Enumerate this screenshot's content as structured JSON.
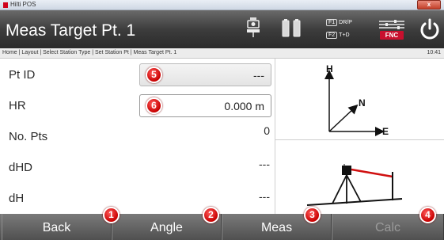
{
  "window": {
    "title": "Hilti POS",
    "close_label": "x"
  },
  "header": {
    "page_title": "Meas Target Pt. 1",
    "f1_key": "F1",
    "f1_label": "DR/P",
    "f2_key": "F2",
    "f2_label": "T+D",
    "fnc_label": "FNC"
  },
  "breadcrumb": {
    "path": "Home | Layout | Select Station Type | Set Station Pt | Meas Target Pt. 1",
    "time": "10:41"
  },
  "form": {
    "rows": [
      {
        "label": "Pt ID",
        "value": "---",
        "badge": "5"
      },
      {
        "label": "HR",
        "value": "0.000 m",
        "badge": "6"
      },
      {
        "label": "No. Pts",
        "value": "0"
      },
      {
        "label": "dHD",
        "value": "---"
      },
      {
        "label": "dH",
        "value": "---"
      }
    ]
  },
  "diagram": {
    "axis_h": "H",
    "axis_n": "N",
    "axis_e": "E"
  },
  "softkeys": [
    {
      "label": "Back",
      "badge": "1",
      "enabled": true
    },
    {
      "label": "Angle",
      "badge": "2",
      "enabled": true
    },
    {
      "label": "Meas",
      "badge": "3",
      "enabled": true
    },
    {
      "label": "Calc",
      "badge": "4",
      "enabled": false
    }
  ],
  "colors": {
    "accent_red": "#c8102e",
    "header_dark": "#3d3d3d",
    "softkey_bar": "#606060"
  }
}
